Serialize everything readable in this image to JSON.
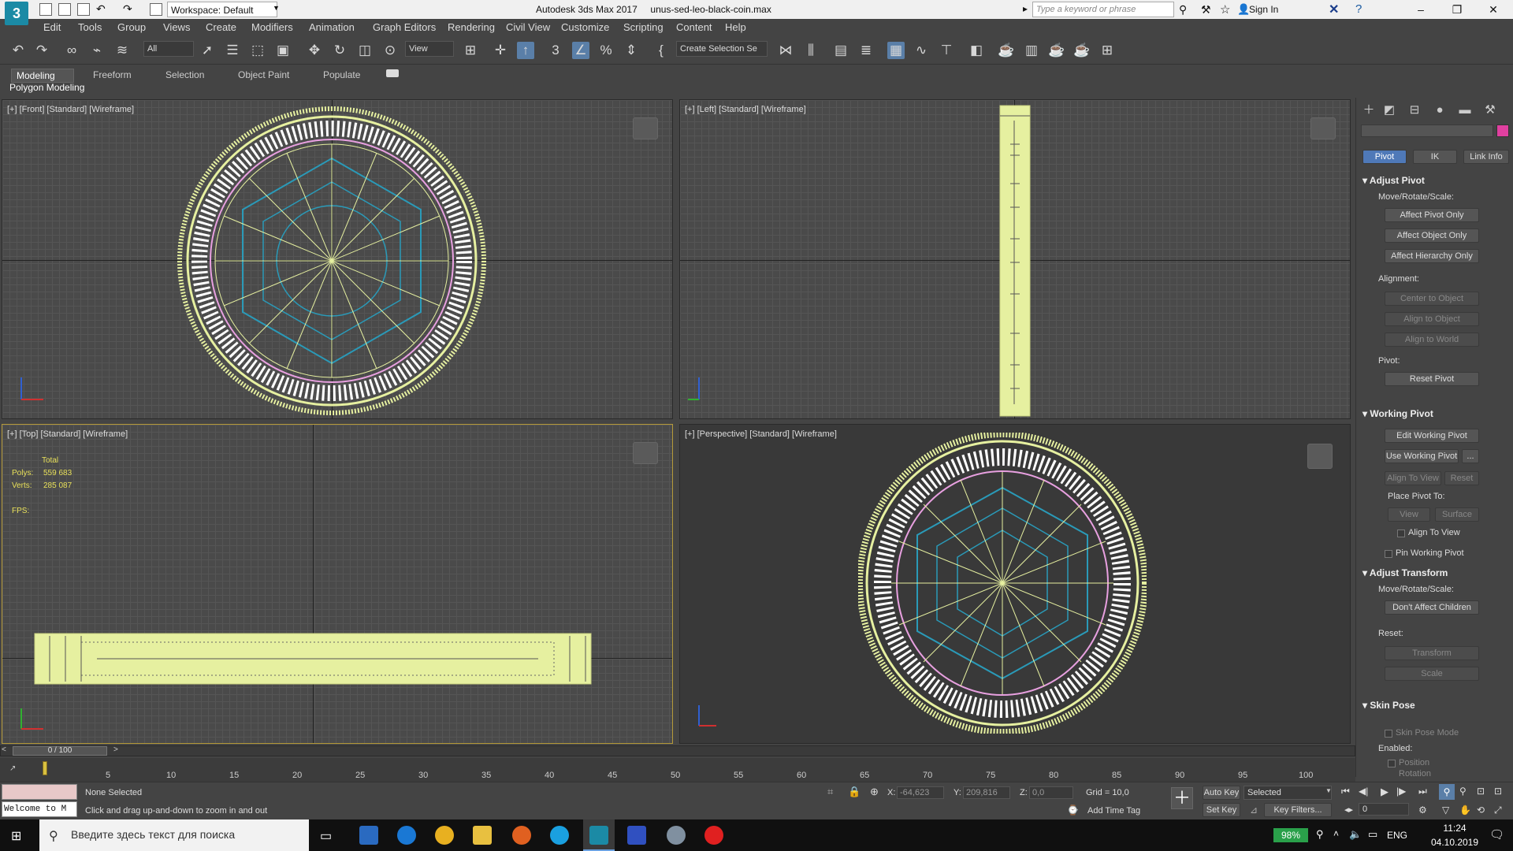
{
  "window": {
    "app_title": "Autodesk 3ds Max 2017",
    "file_name": "unus-sed-leo-black-coin.max",
    "workspace": "Workspace: Default",
    "search_placeholder": "Type a keyword or phrase",
    "sign_in": "Sign In"
  },
  "menu": [
    "Edit",
    "Tools",
    "Group",
    "Views",
    "Create",
    "Modifiers",
    "Animation",
    "Graph Editors",
    "Rendering",
    "Civil View",
    "Customize",
    "Scripting",
    "Content",
    "Help"
  ],
  "toolbar": {
    "selection_filter": "All",
    "ref_coord": "View",
    "selection_set": "Create Selection Se"
  },
  "ribbon": {
    "tabs": [
      "Modeling",
      "Freeform",
      "Selection",
      "Object Paint",
      "Populate"
    ],
    "active_tab": "Modeling",
    "panel_label": "Polygon Modeling"
  },
  "viewports": {
    "front": "[+] [Front] [Standard] [Wireframe]",
    "left": "[+] [Left] [Standard] [Wireframe]",
    "top": "[+] [Top] [Standard] [Wireframe]",
    "perspective": "[+] [Perspective] [Standard] [Wireframe]"
  },
  "stats": {
    "header": "Total",
    "polys_label": "Polys:",
    "polys_value": "559 683",
    "verts_label": "Verts:",
    "verts_value": "285 087",
    "fps_label": "FPS:"
  },
  "command_panel": {
    "tabs": [
      "Pivot",
      "IK",
      "Link Info"
    ],
    "active_tab": "Pivot",
    "color_swatch": "#e040a0",
    "adjust_pivot": {
      "title": "Adjust Pivot",
      "mrs_label": "Move/Rotate/Scale:",
      "btn_pivot_only": "Affect Pivot Only",
      "btn_object_only": "Affect Object Only",
      "btn_hierarchy_only": "Affect Hierarchy Only",
      "alignment_label": "Alignment:",
      "btn_center": "Center to Object",
      "btn_align_object": "Align to Object",
      "btn_align_world": "Align to World",
      "pivot_label": "Pivot:",
      "btn_reset_pivot": "Reset Pivot"
    },
    "working_pivot": {
      "title": "Working Pivot",
      "btn_edit": "Edit Working Pivot",
      "btn_use": "Use Working Pivot",
      "btn_more": "...",
      "btn_align_view": "Align To View",
      "btn_reset": "Reset",
      "place_label": "Place Pivot To:",
      "btn_view": "View",
      "btn_surface": "Surface",
      "chk_align_view": "Align To View",
      "chk_pin": "Pin Working Pivot"
    },
    "adjust_transform": {
      "title": "Adjust Transform",
      "mrs_label": "Move/Rotate/Scale:",
      "btn_dont_affect": "Don't Affect Children",
      "reset_label": "Reset:",
      "btn_transform": "Transform",
      "btn_scale": "Scale"
    },
    "skin_pose": {
      "title": "Skin Pose",
      "chk_mode": "Skin Pose Mode",
      "enabled_label": "Enabled:",
      "chk_position": "Position",
      "chk_rotation": "Rotation"
    }
  },
  "timeline": {
    "frame": "0 / 100",
    "ticks": [
      "5",
      "10",
      "15",
      "20",
      "25",
      "30",
      "35",
      "40",
      "45",
      "50",
      "55",
      "60",
      "65",
      "70",
      "75",
      "80",
      "85",
      "90",
      "95",
      "100"
    ]
  },
  "status": {
    "selection": "None Selected",
    "prompt": "Click and drag up-and-down to zoom in and out",
    "maxscript": "Welcome to M",
    "x_label": "X:",
    "x_value": "-64,623",
    "y_label": "Y:",
    "y_value": "209,816",
    "z_label": "Z:",
    "z_value": "0,0",
    "grid": "Grid = 10,0",
    "add_time_tag": "Add Time Tag",
    "auto_key": "Auto Key",
    "set_key": "Set Key",
    "key_mode": "Selected",
    "key_filters": "Key Filters...",
    "current_frame": "0"
  },
  "taskbar": {
    "search": "Введите здесь текст для поиска",
    "battery": "98%",
    "language": "ENG",
    "time": "11:24",
    "date": "04.10.2019"
  },
  "colors": {
    "wire_yellow": "#e6f0a0",
    "wire_pink": "#e8a0e0",
    "wire_cyan": "#2a9ab8",
    "accent_blue": "#4f79b8"
  }
}
